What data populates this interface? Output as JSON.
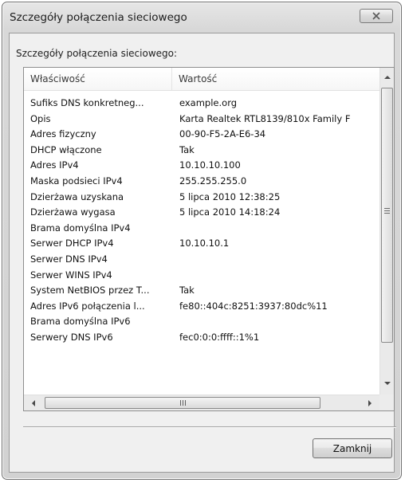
{
  "window": {
    "title": "Szczegóły połączenia sieciowego"
  },
  "group_label": "Szczegóły połączenia sieciowego:",
  "table": {
    "columns": [
      "Właściwość",
      "Wartość"
    ],
    "rows": [
      {
        "property": "Sufiks DNS konkretneg...",
        "value": "example.org"
      },
      {
        "property": "Opis",
        "value": "Karta Realtek RTL8139/810x Family F"
      },
      {
        "property": "Adres fizyczny",
        "value": "00-90-F5-2A-E6-34"
      },
      {
        "property": "DHCP włączone",
        "value": "Tak"
      },
      {
        "property": "Adres IPv4",
        "value": "10.10.10.100"
      },
      {
        "property": "Maska podsieci IPv4",
        "value": "255.255.255.0"
      },
      {
        "property": "Dzierżawa uzyskana",
        "value": "5 lipca 2010 12:38:25"
      },
      {
        "property": "Dzierżawa wygasa",
        "value": "5 lipca 2010 14:18:24"
      },
      {
        "property": "Brama domyślna IPv4",
        "value": ""
      },
      {
        "property": "Serwer DHCP IPv4",
        "value": "10.10.10.1"
      },
      {
        "property": "Serwer DNS IPv4",
        "value": ""
      },
      {
        "property": "Serwer WINS IPv4",
        "value": ""
      },
      {
        "property": "System NetBIOS przez T...",
        "value": "Tak"
      },
      {
        "property": "Adres IPv6 połączenia l...",
        "value": "fe80::404c:8251:3937:80dc%11"
      },
      {
        "property": "Brama domyślna IPv6",
        "value": ""
      },
      {
        "property": "Serwery DNS IPv6",
        "value": "fec0:0:0:ffff::1%1"
      }
    ]
  },
  "scrollbar": {
    "thumb_grip": "≡",
    "hthumb_grip": "III"
  },
  "buttons": {
    "close_label": "Zamknij"
  },
  "icons": {
    "title_close": "close-icon"
  }
}
